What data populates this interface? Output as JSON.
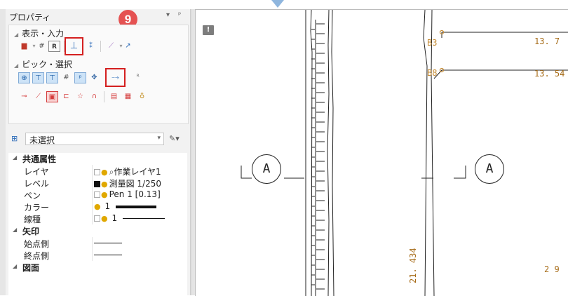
{
  "panel": {
    "title": "プロパティ",
    "title_controls": [
      "▾",
      "ᵖ"
    ],
    "step_badge": "9"
  },
  "ribbon": {
    "group_display_input": "表示・入力",
    "group_pick_select": "ピック・選択",
    "display_input_icons": [
      "layer-icon",
      "grid-icon",
      "r-icon",
      "pen-vertical-icon",
      "snap-icon",
      "wand-icon",
      "dropper-icon"
    ],
    "pick_row1_icons": [
      "pick-crosshair-icon",
      "pick-p1-icon",
      "pick-p2-icon",
      "pick-grid-icon",
      "pick-p3-icon",
      "pick-arrows-icon",
      "pick-line-p-icon",
      "pick-rp-icon"
    ],
    "pick_row2_icons": [
      "line-pick-icon",
      "pen-pick-icon",
      "square-pick-icon",
      "bracket-pick-icon",
      "shape-pick-icon",
      "curve-pick-icon",
      "select-box-icon",
      "select-image-icon",
      "bag-icon"
    ]
  },
  "selector": {
    "value": "未選択"
  },
  "properties": {
    "category_common": "共通属性",
    "category_arrow": "矢印",
    "category_drawing": "図面",
    "rows_common": [
      {
        "key": "レイヤ",
        "value": "作業レイヤ1"
      },
      {
        "key": "レベル",
        "value": "測量図 1/250"
      },
      {
        "key": "ペン",
        "value": "Pen 1 [0.13]"
      },
      {
        "key": "カラー",
        "value": "1"
      },
      {
        "key": "線種",
        "value": "1"
      }
    ],
    "rows_arrow": [
      {
        "key": "始点側",
        "value": ""
      },
      {
        "key": "終点側",
        "value": ""
      }
    ]
  },
  "drawing": {
    "info_bubble": "!",
    "label_b3": "B3",
    "label_b8": "B8",
    "dim_top": "13. 7",
    "dim_second": "13. 54",
    "circle_label_left": "A",
    "circle_label_right": "A",
    "vertical_dimension": "21. 434",
    "right_number": "2 9"
  },
  "colors": {
    "badge": "#e55252",
    "highlight_box": "#d42020",
    "drawing_label": "#c48a33"
  }
}
